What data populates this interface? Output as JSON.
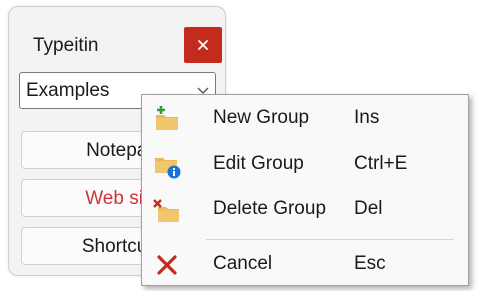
{
  "window": {
    "title": "Typeitin",
    "close_label": "x",
    "group_select": {
      "selected": "Examples"
    },
    "entries": [
      {
        "label": "Notepad"
      },
      {
        "label": "Web site"
      },
      {
        "label": "Shortcuts"
      }
    ]
  },
  "context_menu": {
    "items": [
      {
        "label": "New Group",
        "shortcut": "Ins",
        "icon": "new-folder-icon"
      },
      {
        "label": "Edit Group",
        "shortcut": "Ctrl+E",
        "icon": "edit-folder-icon"
      },
      {
        "label": "Delete Group",
        "shortcut": "Del",
        "icon": "delete-folder-icon"
      },
      {
        "label": "Cancel",
        "shortcut": "Esc",
        "icon": "cancel-icon"
      }
    ]
  },
  "colors": {
    "close_button": "#c42b1c",
    "entry_highlight_text": "#d13438",
    "folder": "#e8b85a",
    "add_green": "#2e9d3a",
    "info_blue": "#1a73d9",
    "cancel_red": "#c42b1c"
  }
}
